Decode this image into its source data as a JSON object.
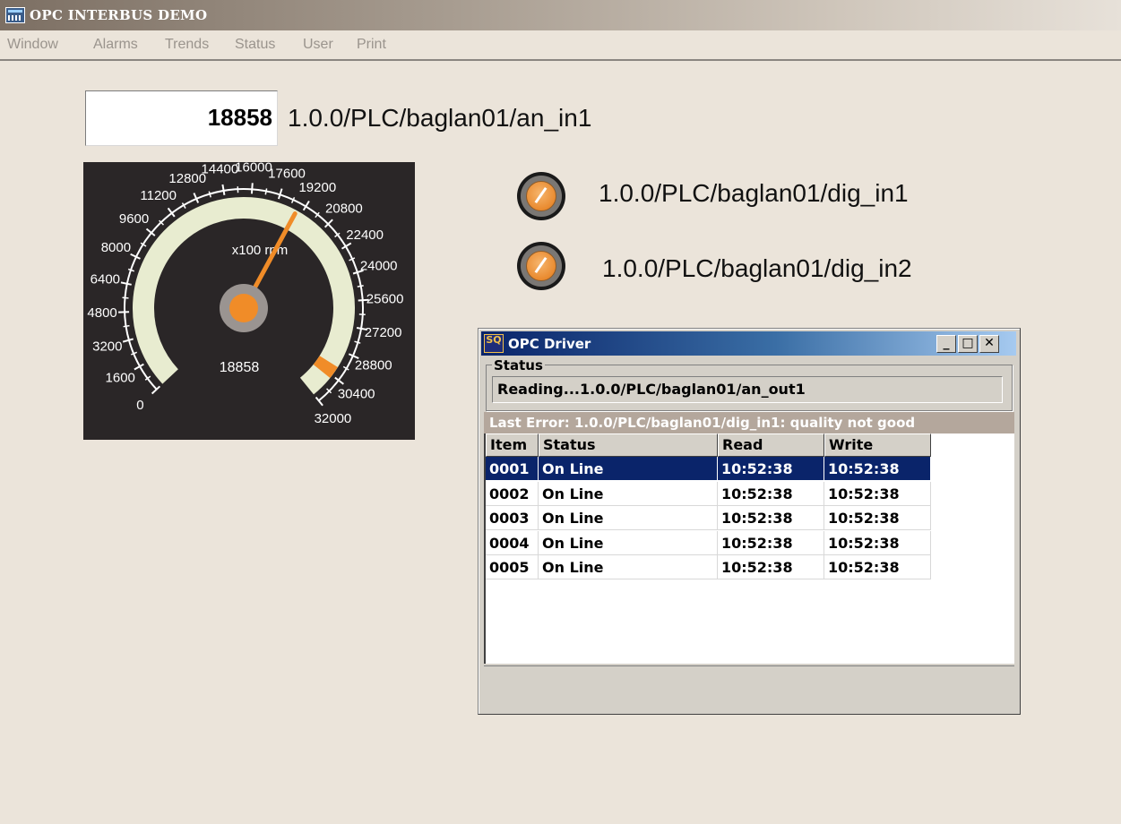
{
  "window": {
    "title": "OPC INTERBUS DEMO"
  },
  "menu": [
    "Window",
    "Alarms",
    "Trends",
    "Status",
    "User",
    "Print"
  ],
  "analog": {
    "value": "18858",
    "tag": "1.0.0/PLC/baglan01/an_in1"
  },
  "gauge": {
    "unit_label": "x100 rpm",
    "readout": "18858",
    "value": 18858,
    "min": 0,
    "max": 32000,
    "ticks": [
      "0",
      "1600",
      "3200",
      "4800",
      "6400",
      "8000",
      "9600",
      "11200",
      "12800",
      "14400",
      "16000",
      "17600",
      "19200",
      "20800",
      "22400",
      "24000",
      "25600",
      "27200",
      "28800",
      "30400",
      "32000"
    ],
    "colors": {
      "band": "#e8ecd0",
      "marker": "#f08c28",
      "needle": "#f08c28",
      "hub": "#9a9491",
      "background": "#2a2627"
    }
  },
  "digital": [
    {
      "tag": "1.0.0/PLC/baglan01/dig_in1",
      "color": "#e98a2f"
    },
    {
      "tag": "1.0.0/PLC/baglan01/dig_in2",
      "color": "#e98a2f"
    }
  ],
  "opc": {
    "title": "OPC Driver",
    "icon_text": "SQ",
    "buttons": {
      "minimize": "_",
      "maximize": "□",
      "close": "✕"
    },
    "status_legend": "Status",
    "status_text": "Reading...1.0.0/PLC/baglan01/an_out1",
    "last_error": "Last Error: 1.0.0/PLC/baglan01/dig_in1: quality not good",
    "columns": [
      "Item",
      "Status",
      "Read",
      "Write"
    ],
    "rows": [
      {
        "item": "0001",
        "status": "On Line",
        "read": "10:52:38",
        "write": "10:52:38",
        "selected": true
      },
      {
        "item": "0002",
        "status": "On Line",
        "read": "10:52:38",
        "write": "10:52:38",
        "selected": false
      },
      {
        "item": "0003",
        "status": "On Line",
        "read": "10:52:38",
        "write": "10:52:38",
        "selected": false
      },
      {
        "item": "0004",
        "status": "On Line",
        "read": "10:52:38",
        "write": "10:52:38",
        "selected": false
      },
      {
        "item": "0005",
        "status": "On Line",
        "read": "10:52:38",
        "write": "10:52:38",
        "selected": false
      }
    ]
  }
}
